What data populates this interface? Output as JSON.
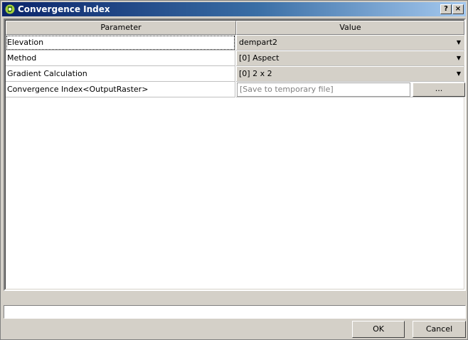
{
  "window": {
    "title": "Convergence Index",
    "help_label": "?",
    "close_label": "×"
  },
  "table": {
    "headers": {
      "parameter": "Parameter",
      "value": "Value"
    },
    "rows": [
      {
        "param": "Elevation",
        "value": "dempart2"
      },
      {
        "param": "Method",
        "value": "[0] Aspect"
      },
      {
        "param": "Gradient Calculation",
        "value": "[0] 2 x 2"
      },
      {
        "param": "Convergence Index<OutputRaster>",
        "placeholder": "[Save to temporary file]",
        "browse_label": "..."
      }
    ]
  },
  "buttons": {
    "ok": "OK",
    "cancel": "Cancel"
  },
  "colors": {
    "title_gradient_start": "#0a246a",
    "title_gradient_end": "#a6caf0",
    "face": "#d4d0c8"
  }
}
